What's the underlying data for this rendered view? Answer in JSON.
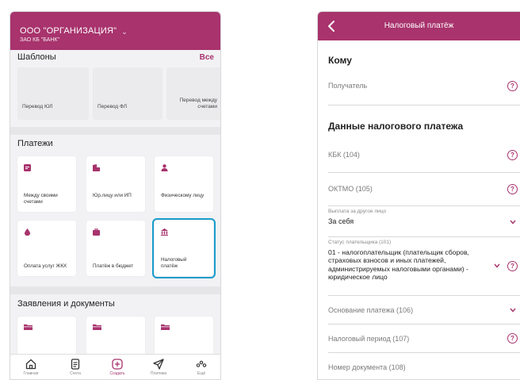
{
  "left": {
    "org_name": "ООО \"ОРГАНИЗАЦИЯ\"",
    "bank_name": "ЗАО КБ \"БАНК\"",
    "templates_title": "Шаблоны",
    "templates_all": "Все",
    "templates": [
      "Перевод ЮЛ",
      "Перевод ФЛ",
      "Перевод между счетами"
    ],
    "payments_title": "Платежи",
    "payments": [
      {
        "label": "Между своими счетами",
        "icon": "card-icon"
      },
      {
        "label": "Юр.лицу или ИП",
        "icon": "building-icon"
      },
      {
        "label": "Физическому лицу",
        "icon": "person-icon"
      },
      {
        "label": "Оплата услуг ЖКХ",
        "icon": "drop-icon"
      },
      {
        "label": "Платёж в бюджет",
        "icon": "briefcase-icon"
      },
      {
        "label": "Налоговый платёж",
        "icon": "bank-icon"
      }
    ],
    "docs_title": "Заявления и документы",
    "tabs": [
      "Главная",
      "Счета",
      "Создать",
      "Платежи",
      "Ещё"
    ],
    "accent": "#a8336d",
    "highlight": "#1a9ccc"
  },
  "right": {
    "title": "Налоговый платёж",
    "to_heading": "Кому",
    "recipient_placeholder": "Получатель",
    "tax_heading": "Данные налогового платежа",
    "kbk_placeholder": "КБК (104)",
    "oktmo_placeholder": "ОКТМО (105)",
    "payout_label": "Выплата за другое лицо",
    "payout_value": "За себя",
    "status_label": "Статус плательщика (101)",
    "status_value": "01 - налогоплательщик (плательщик сборов, страховых взносов и иных платежей, администрируемых налоговыми органами) - юридическое лицо",
    "basis_placeholder": "Основание платежа (106)",
    "period_placeholder": "Налоговый период (107)",
    "docnum_placeholder": "Номер документа (108)",
    "help_glyph": "?"
  }
}
